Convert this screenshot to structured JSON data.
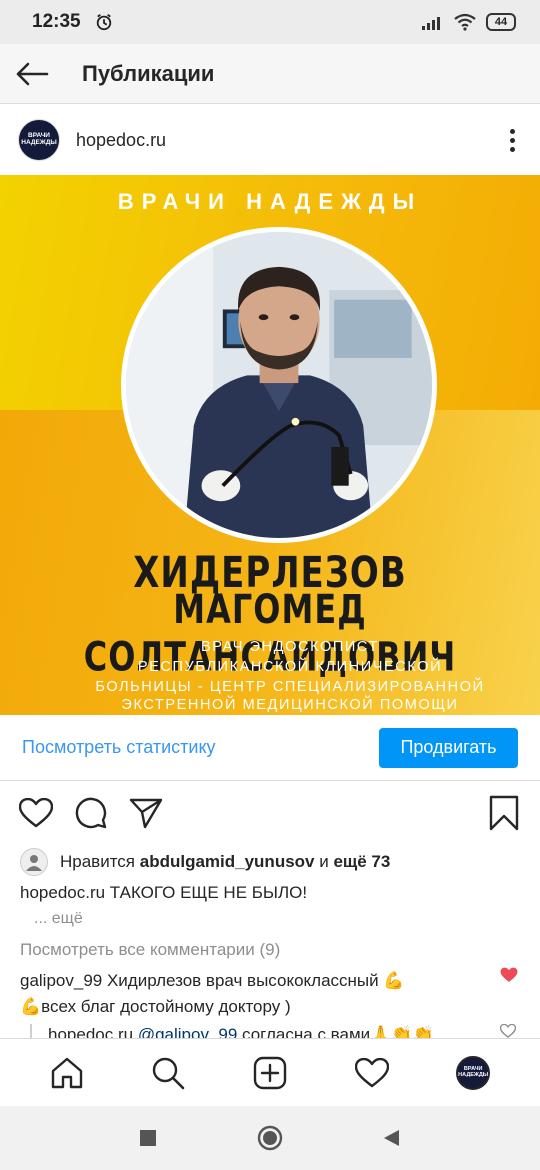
{
  "status_bar": {
    "time": "12:35",
    "battery": "44",
    "icons": [
      "alarm-icon",
      "signal-icon",
      "wifi-icon",
      "battery-icon"
    ]
  },
  "top_bar": {
    "title": "Публикации",
    "back_icon": "arrow-left-icon"
  },
  "post": {
    "username": "hopedoc.ru",
    "avatar_text_1": "ВРАЧИ",
    "avatar_text_2": "НАДЕЖДЫ",
    "image": {
      "brand_title": "ВРАЧИ НАДЕЖДЫ",
      "name_line_1": "ХИДЕРЛЕЗОВ",
      "name_line_2": "МАГОМЕД СОЛТАНСАИДОВИЧ",
      "desc_line_1": "ВРАЧ ЭНДОСКОПИСТ",
      "desc_line_2": "РЕСПУБЛИКАНСКОЙ КЛИНИЧЕСКОЙ",
      "desc_line_3": "БОЛЬНИЦЫ - ЦЕНТР СПЕЦИАЛИЗИРОВАННОЙ",
      "desc_line_4": "ЭКСТРЕННОЙ МЕДИЦИНСКОЙ ПОМОЩИ"
    },
    "stats_link": "Посмотреть статистику",
    "promote_label": "Продвигать",
    "likes": {
      "prefix": "Нравится ",
      "user": "abdulgamid_yunusov",
      "middle": " и ",
      "count": "ещё 73"
    },
    "caption": {
      "user": "hopedoc.ru",
      "text": " ТАКОГО ЕЩЕ НЕ БЫЛО!",
      "more": "... ещё"
    },
    "view_comments": "Посмотреть все комментарии (9)",
    "comment": {
      "user": "galipov_99",
      "text_line_1": " Хидирлезов врач высококлассный 💪",
      "text_line_2": "💪всех благ достойному доктору )"
    },
    "reply": {
      "user": "hopedoc.ru",
      "mention": "@galipov_99",
      "text": " согласна с вами🙏👏👏"
    }
  },
  "colors": {
    "accent": "#0095f6",
    "link": "#3897f0",
    "like_red": "#ed4956",
    "brand_yellow": "#f5b90a"
  },
  "bottom_nav": [
    "home-icon",
    "search-icon",
    "add-post-icon",
    "activity-heart-icon",
    "profile-avatar"
  ],
  "system_nav": [
    "recents-square-icon",
    "home-circle-icon",
    "back-triangle-icon"
  ]
}
